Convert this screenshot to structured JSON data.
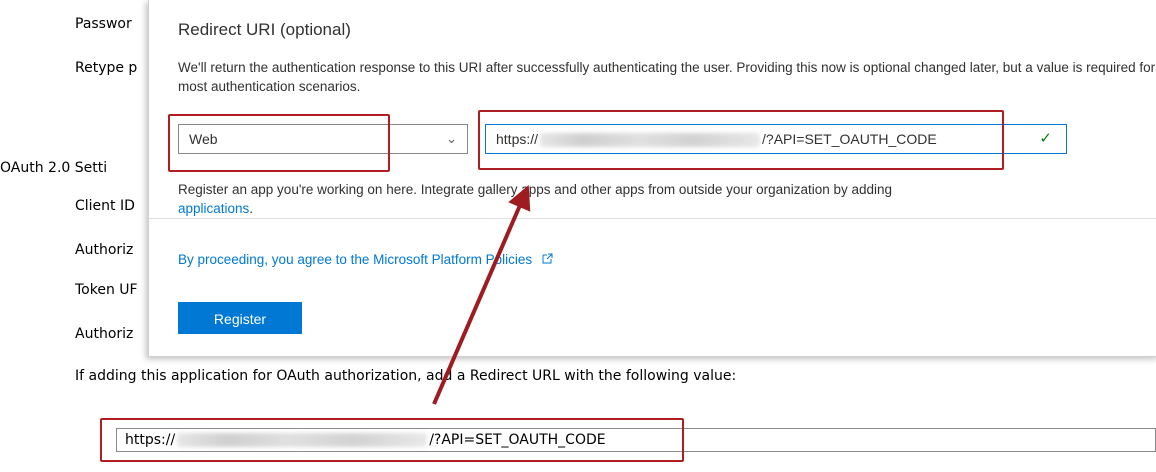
{
  "background": {
    "password_label": "Passwor",
    "retype_label": "Retype p",
    "oauth_section": "OAuth 2.0 Setti",
    "client_id_label": "Client ID",
    "authorization_label_1": "Authoriz",
    "token_label": "Token UF",
    "authorization_label_2": "Authoriz",
    "redirect_instruction": "If adding this application for OAuth authorization, add a Redirect URL with the following value:",
    "redirect_prefix": "https://",
    "redirect_suffix": "/?API=SET_OAUTH_CODE"
  },
  "panel": {
    "title": "Redirect URI (optional)",
    "description": "We'll return the authentication response to this URI after successfully authenticating the user. Providing this now is optional changed later, but a value is required for most authentication scenarios.",
    "platform_select": "Web",
    "uri_prefix": "https://",
    "uri_suffix": "/?API=SET_OAUTH_CODE",
    "register_text": "Register an app you're working on here. Integrate gallery apps and other apps from outside your organization by adding",
    "register_link": "applications",
    "register_end": ".",
    "policy_link": "By proceeding, you agree to the Microsoft Platform Policies",
    "register_button": "Register"
  },
  "colors": {
    "accent": "#0078d4",
    "highlight": "#b01e23",
    "valid": "#107c10"
  },
  "icons": {
    "chevron": "chevron-down-icon",
    "check": "checkmark-icon",
    "external": "external-link-icon"
  }
}
